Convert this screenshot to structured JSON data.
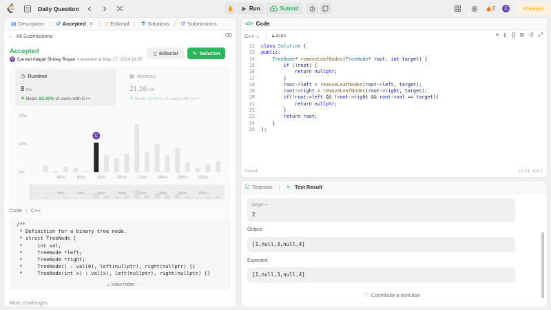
{
  "header": {
    "title": "Daily Question",
    "run_label": "Run",
    "submit_label": "Submit",
    "streak_count": "2",
    "avatar_letter": "C",
    "premium_label": "Premium"
  },
  "left_tabs": [
    {
      "label": "Description",
      "icon": "description-icon"
    },
    {
      "label": "Accepted",
      "icon": "clock-icon"
    },
    {
      "label": "Editorial",
      "icon": "book-icon"
    },
    {
      "label": "Solutions",
      "icon": "flask-icon"
    },
    {
      "label": "Submissions",
      "icon": "history-icon"
    }
  ],
  "submission": {
    "back_label": "All Submissions",
    "status": "Accepted",
    "user_initial": "C",
    "user": "Carmel Abigail Shirley Royan",
    "submitted_text": "submitted at May 17, 2024 18:35",
    "editorial_button": "Editorial",
    "solution_button": "Solution"
  },
  "runtime": {
    "title": "Runtime",
    "value": "8",
    "unit": "ms",
    "beats_prefix": "Beats",
    "beats_pct": "82.40%",
    "beats_suffix": "of users with C++"
  },
  "memory": {
    "title": "Memory",
    "value": "21.16",
    "unit": "MB",
    "beats_prefix": "Beats",
    "beats_pct": "82.90%",
    "beats_suffix": "of users with C++"
  },
  "chart_data": {
    "type": "bar",
    "title": "",
    "xlabel": "",
    "ylabel": "",
    "y_ticks": [
      "20%",
      "10%",
      "0%"
    ],
    "ylim": [
      0,
      20
    ],
    "x_tick_labels": [
      "4ms",
      "6ms",
      "8ms",
      "10ms",
      "12ms",
      "14ms",
      "16ms",
      "18ms"
    ],
    "values": [
      0,
      2.5,
      0.5,
      2.0,
      1.5,
      0.5,
      10.5,
      6.0,
      5.0,
      6.5,
      17.0,
      7.0,
      10.0,
      6.0,
      8.5,
      3.5,
      1.5,
      3.0,
      4.0
    ],
    "highlight_index": 6,
    "highlight_marker": "C",
    "bar_color": "#e6e6e6",
    "highlight_color": "#262626",
    "grid": true
  },
  "code_preview": {
    "label": "Code",
    "language": "C++",
    "lines": [
      "/**",
      " * Definition for a binary tree node.",
      " * struct TreeNode {",
      " *     int val;",
      " *     TreeNode *left;",
      " *     TreeNode *right;",
      " *     TreeNode() : val(0), left(nullptr), right(nullptr) {}",
      " *     TreeNode(int x) : val(x), left(nullptr), right(nullptr) {}"
    ],
    "view_more": "View more"
  },
  "more_challenges": "More challenges",
  "editor": {
    "title": "Code",
    "language": "C++",
    "mode": "Auto",
    "saved_label": "Saved",
    "cursor_pos": "Ln 21, Col 1",
    "line_numbers": [
      "12",
      "13",
      "14",
      "15",
      "16",
      "17",
      "18",
      "19",
      "20",
      "21",
      "22",
      "23",
      "24",
      "25"
    ]
  },
  "test": {
    "tab_testcase": "Testcase",
    "tab_result": "Test Result",
    "input_label": "target =",
    "input_value": "2",
    "output_label": "Output",
    "output_value": "[1,null,3,null,4]",
    "expected_label": "Expected",
    "expected_value": "[1,null,3,null,4]",
    "contribute": "Contribute a testcase"
  },
  "colors": {
    "accent_green": "#2db55d",
    "brand_orange": "#ffa116",
    "avatar_purple": "#6b4ba8"
  }
}
